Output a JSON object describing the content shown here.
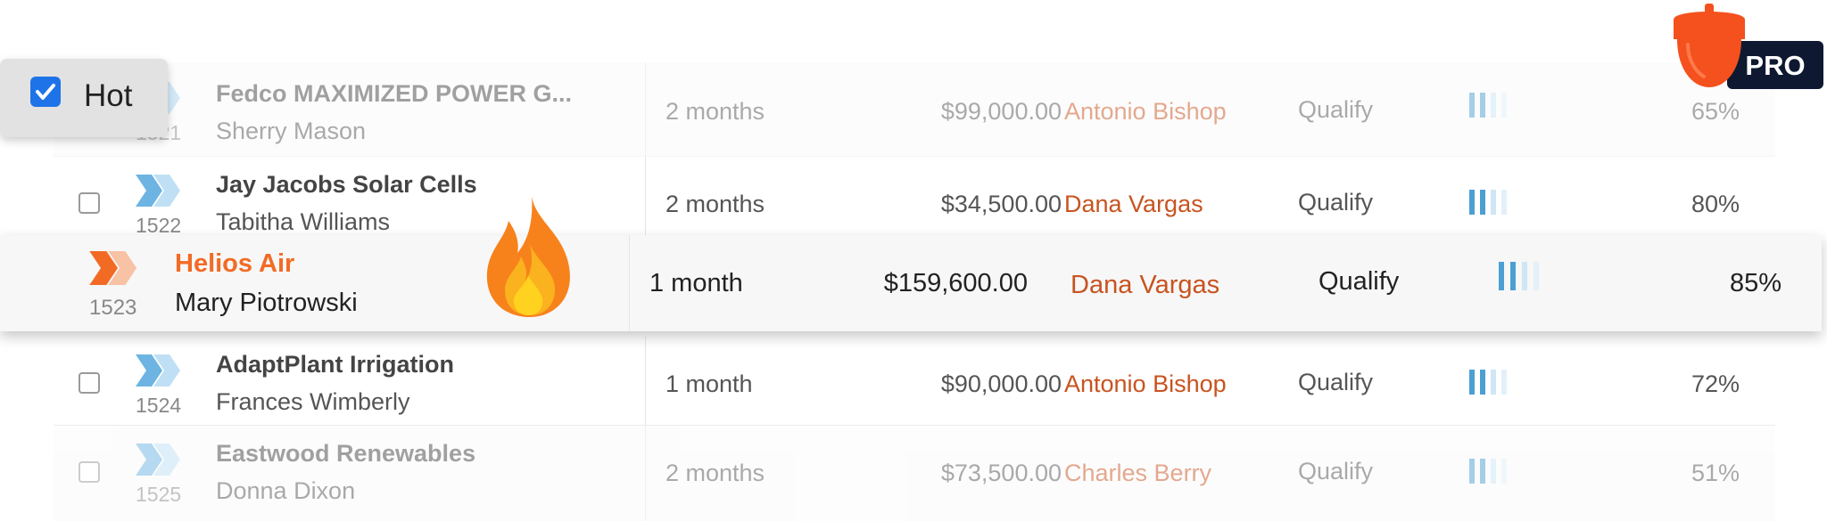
{
  "hot_toggle": {
    "label": "Hot",
    "checked": true
  },
  "badge": {
    "label": "PRO",
    "icon": "acorn-icon"
  },
  "rows": [
    {
      "id": "1521",
      "company": "Fedco MAXIMIZED POWER G...",
      "contact": "Sherry Mason",
      "age": "2 months",
      "amount": "$99,000.00",
      "owner": "Antonio Bishop",
      "stage": "Qualify",
      "probability": "65%"
    },
    {
      "id": "1522",
      "company": "Jay Jacobs Solar Cells",
      "contact": "Tabitha Williams",
      "age": "2 months",
      "amount": "$34,500.00",
      "owner": "Dana Vargas",
      "stage": "Qualify",
      "probability": "80%"
    },
    {
      "id": "1523",
      "company": "Helios Air",
      "contact": "Mary Piotrowski",
      "age": "1 month",
      "amount": "$159,600.00",
      "owner": "Dana Vargas",
      "stage": "Qualify",
      "probability": "85%",
      "hot": true
    },
    {
      "id": "1524",
      "company": "AdaptPlant Irrigation",
      "contact": "Frances Wimberly",
      "age": "1 month",
      "amount": "$90,000.00",
      "owner": "Antonio Bishop",
      "stage": "Qualify",
      "probability": "72%"
    },
    {
      "id": "1525",
      "company": "Eastwood Renewables",
      "contact": "Donna Dixon",
      "age": "2 months",
      "amount": "$73,500.00",
      "owner": "Charles Berry",
      "stage": "Qualify",
      "probability": "51%"
    }
  ],
  "colors": {
    "accent_orange": "#f26b25",
    "owner_text": "#c8531f",
    "chevron_blue": "#4b9fd2",
    "chevron_orange": "#f26b25",
    "badge_navy": "#0e1931"
  },
  "icons": {
    "row_status": "chevron-stage-icon",
    "hot_marker": "fire-icon"
  }
}
